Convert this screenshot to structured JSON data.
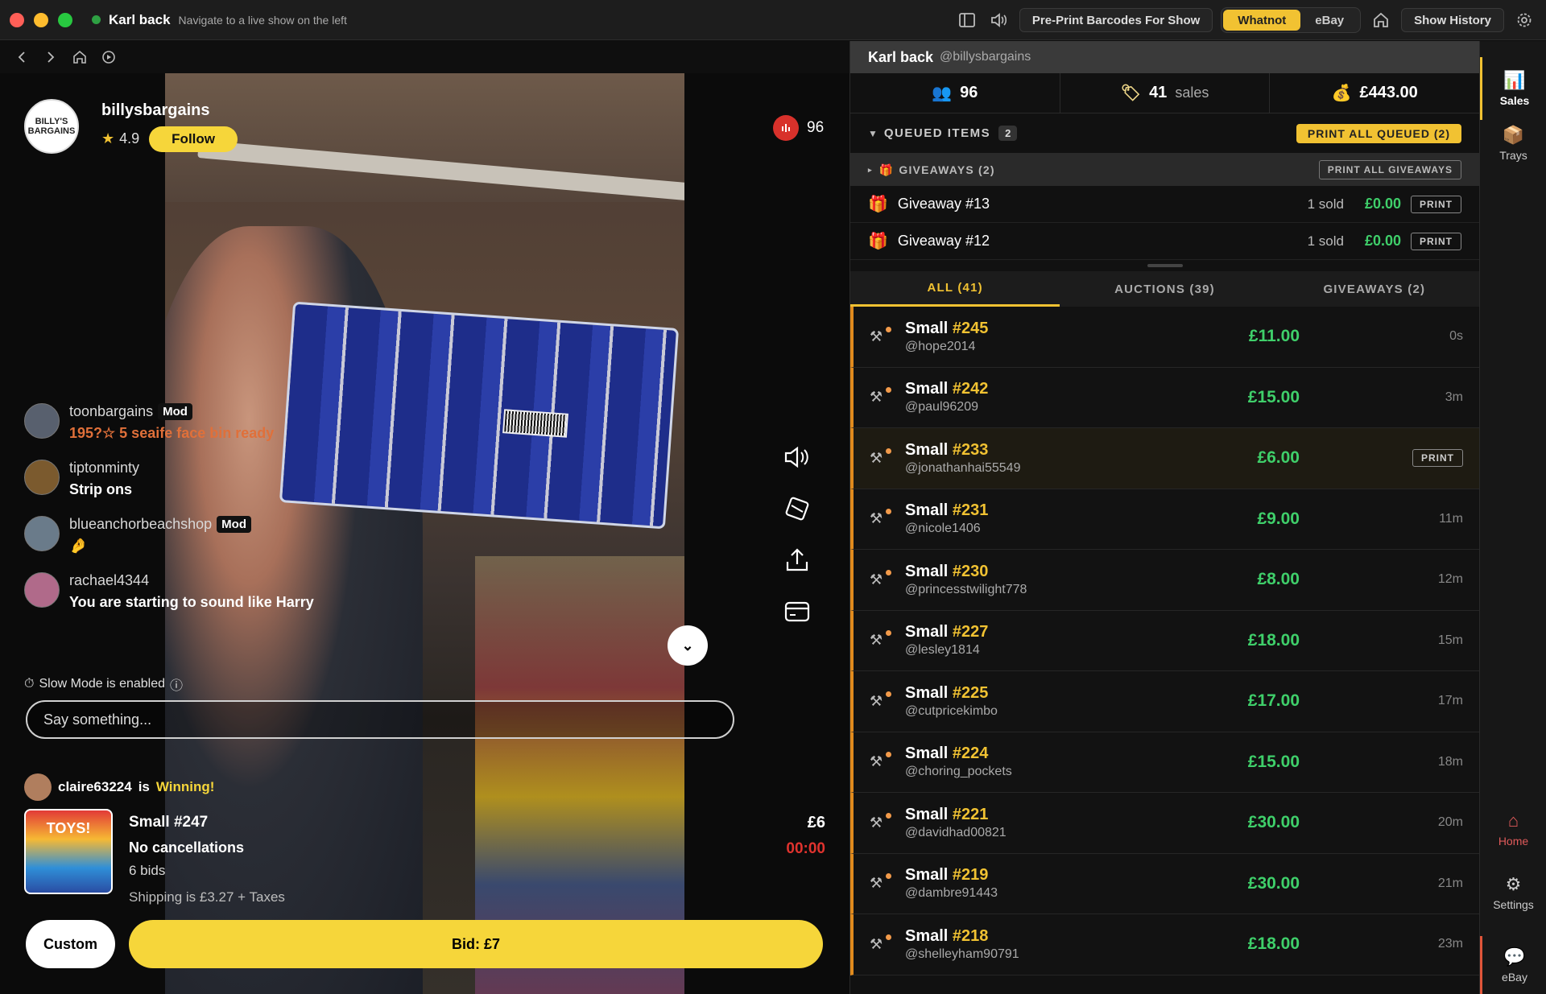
{
  "window": {
    "title": "Karl back",
    "subtitle": "Navigate to a live show on the left",
    "preprint_label": "Pre-Print Barcodes For Show",
    "seg_whatnot": "Whatnot",
    "seg_ebay": "eBay",
    "show_history_label": "Show History"
  },
  "seller": {
    "avatar_text": "BILLY'S BARGAINS",
    "name": "billysbargains",
    "rating": "4.9",
    "follow_label": "Follow",
    "viewers": "96"
  },
  "chat": [
    {
      "user": "toonbargains",
      "badge": "Mod",
      "text": "195?☆ 5 seaife face bin ready"
    },
    {
      "user": "tiptonminty",
      "badge": "",
      "text": "Strip ons"
    },
    {
      "user": "blueanchorbeachshop",
      "badge": "Mod",
      "text": "🤌"
    },
    {
      "user": "rachael4344",
      "badge": "",
      "text": "You are starting to sound like Harry"
    }
  ],
  "slow_mode": "Slow Mode is enabled",
  "input": {
    "placeholder": "Say something..."
  },
  "auction": {
    "winner": "claire63224",
    "winning_mid": "is",
    "winning_word": "Winning!",
    "thumb_text": "TOYS!",
    "title": "Small #247",
    "note": "No cancellations",
    "bids": "6 bids",
    "shipping": "Shipping is £3.27 + Taxes",
    "price": "£6",
    "timer": "00:00",
    "custom_label": "Custom",
    "bid_label": "Bid: £7"
  },
  "panel": {
    "name": "Karl back",
    "handle": "@billysbargains",
    "viewers": "96",
    "sales_count": "41",
    "sales_word": "sales",
    "revenue": "£443.00",
    "queued_label": "QUEUED ITEMS",
    "queued_count": "2",
    "print_all_queued": "PRINT ALL QUEUED (2)",
    "giveaways_label": "GIVEAWAYS (2)",
    "print_all_giveaways": "PRINT ALL GIVEAWAYS",
    "giveaways": [
      {
        "name": "Giveaway #13",
        "sold": "1 sold",
        "amount": "£0.00",
        "print": "PRINT"
      },
      {
        "name": "Giveaway #12",
        "sold": "1 sold",
        "amount": "£0.00",
        "print": "PRINT"
      }
    ],
    "tabs": [
      "ALL (41)",
      "AUCTIONS (39)",
      "GIVEAWAYS (2)"
    ],
    "sales": [
      {
        "prefix": "Small ",
        "num": "#245",
        "user": "@hope2014",
        "price": "£11.00",
        "time": "0s"
      },
      {
        "prefix": "Small ",
        "num": "#242",
        "user": "@paul96209",
        "price": "£15.00",
        "time": "3m"
      },
      {
        "prefix": "Small ",
        "num": "#233",
        "user": "@jonathanhai55549",
        "price": "£6.00",
        "time": "PRINT"
      },
      {
        "prefix": "Small ",
        "num": "#231",
        "user": "@nicole1406",
        "price": "£9.00",
        "time": "11m"
      },
      {
        "prefix": "Small ",
        "num": "#230",
        "user": "@princesstwilight778",
        "price": "£8.00",
        "time": "12m"
      },
      {
        "prefix": "Small ",
        "num": "#227",
        "user": "@lesley1814",
        "price": "£18.00",
        "time": "15m"
      },
      {
        "prefix": "Small ",
        "num": "#225",
        "user": "@cutpricekimbo",
        "price": "£17.00",
        "time": "17m"
      },
      {
        "prefix": "Small ",
        "num": "#224",
        "user": "@choring_pockets",
        "price": "£15.00",
        "time": "18m"
      },
      {
        "prefix": "Small ",
        "num": "#221",
        "user": "@davidhad00821",
        "price": "£30.00",
        "time": "20m"
      },
      {
        "prefix": "Small ",
        "num": "#219",
        "user": "@dambre91443",
        "price": "£30.00",
        "time": "21m"
      },
      {
        "prefix": "Small ",
        "num": "#218",
        "user": "@shelleyham90791",
        "price": "£18.00",
        "time": "23m"
      }
    ]
  },
  "sidebar": {
    "sales": "Sales",
    "trays": "Trays",
    "home": "Home",
    "settings": "Settings",
    "ebay": "eBay"
  }
}
